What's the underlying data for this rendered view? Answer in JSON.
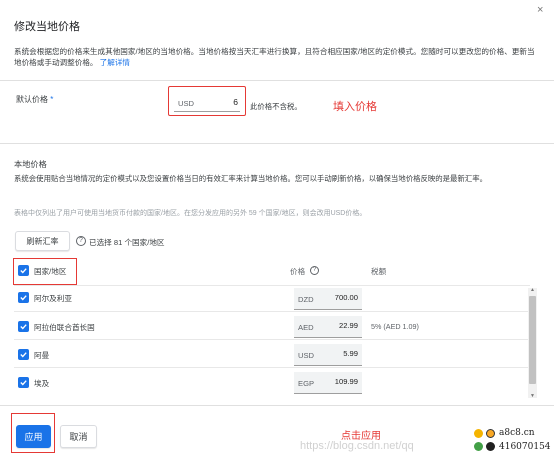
{
  "dialog": {
    "title": "修改当地价格",
    "close_icon": "×",
    "description": "系统会根据您的价格来生成其他国家/地区的当地价格。当地价格按当天汇率进行换算，且符合相应国家/地区的定价模式。您随时可以更改您的价格、更新当地价格或手动调整价格。",
    "learn_more": "了解详情"
  },
  "default_price": {
    "label": "默认价格",
    "required_mark": "*",
    "currency": "USD",
    "value": "6",
    "tax_note": "此价格不含税。",
    "annotation": "填入价格"
  },
  "local_price": {
    "heading": "本地价格",
    "description": "系统会使用贴合当地情况的定价模式以及您设置价格当日的有效汇率来计算当地价格。您可以手动刷新价格，以确保当地价格反映的是最新汇率。",
    "note": "表格中仅列出了用户可使用当地货币付款的国家/地区。在您分发应用的另外 59 个国家/地区，则会改用USD价格。",
    "refresh_button": "刷新汇率",
    "selected_text": "已选择 81 个国家/地区"
  },
  "table": {
    "col_country": "国家/地区",
    "col_price": "价格",
    "col_tax": "税额",
    "rows": [
      {
        "country": "阿尔及利亚",
        "currency": "DZD",
        "price": "700.00",
        "tax": ""
      },
      {
        "country": "阿拉伯联合酋长国",
        "currency": "AED",
        "price": "22.99",
        "tax": "5% (AED 1.09)"
      },
      {
        "country": "阿曼",
        "currency": "USD",
        "price": "5.99",
        "tax": ""
      },
      {
        "country": "埃及",
        "currency": "EGP",
        "price": "109.99",
        "tax": ""
      }
    ]
  },
  "footer": {
    "apply_button": "应用",
    "cancel_button": "取消",
    "annotation": "点击应用",
    "watermark": "https://blog.csdn.net/qq",
    "site_text": "a8c8.cn",
    "qq_text": "416070154"
  },
  "colors": {
    "primary": "#1a73e8",
    "annotation_red": "#e53935"
  }
}
